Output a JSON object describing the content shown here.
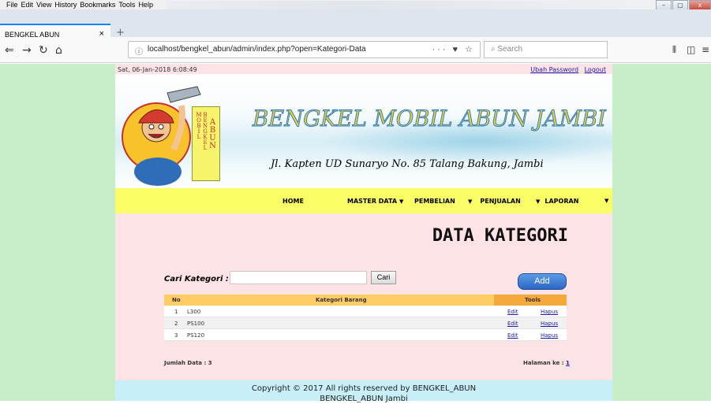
{
  "browser": {
    "menu": [
      "File",
      "Edit",
      "View",
      "History",
      "Bookmarks",
      "Tools",
      "Help"
    ],
    "tab_title": "BENGKEL ABUN",
    "tab_close": "×",
    "new_tab": "+",
    "url": "localhost/bengkel_abun/admin/index.php?open=Kategori-Data",
    "url_actions": "··· ♥ ☆",
    "search_placeholder": "Search",
    "win_controls": [
      "–",
      "▢",
      "x"
    ]
  },
  "page": {
    "datetime": "Sat, 06-Jan-2018 6:08:49",
    "links": [
      "Ubah Password",
      "Logout"
    ],
    "banner": {
      "title": "BENGKEL MOBIL ABUN JAMBI",
      "address": "Jl. Kapten UD Sunaryo No. 85 Talang Bakung, Jambi",
      "sign_left": "BENGKEL MOBIL",
      "sign_right": "ABUN"
    },
    "nav": {
      "home": "HOME",
      "master": "MASTER DATA",
      "pembelian": "PEMBELIAN",
      "penjualan": "PENJUALAN",
      "laporan": "LAPORAN",
      "caret": "▼"
    },
    "heading": "DATA KATEGORI",
    "search": {
      "label": "Cari Kategori :",
      "value": "",
      "button": "Cari"
    },
    "add_button": "Add",
    "table": {
      "headers": {
        "no": "No",
        "kategori": "Kategori Barang",
        "tools": "Tools"
      },
      "rows": [
        {
          "no": "1",
          "name": "L300",
          "edit": "Edit",
          "hapus": "Hapus"
        },
        {
          "no": "2",
          "name": "PS100",
          "edit": "Edit",
          "hapus": "Hapus"
        },
        {
          "no": "3",
          "name": "PS120",
          "edit": "Edit",
          "hapus": "Hapus"
        }
      ]
    },
    "total": "Jumlah Data : 3",
    "page_label": "Halaman ke :",
    "page_number": "1",
    "footer": [
      "Copyright © 2017 All rights reserved by BENGKEL_ABUN",
      "BENGKEL_ABUN Jambi"
    ]
  },
  "colors": {
    "page_bg": "#fde3e5",
    "side_bg": "#c8eec9",
    "nav_bg": "#fbfd66",
    "table_head": "#ffcc66",
    "tools_head": "#f5a93a",
    "footer_bg": "#c8eef8",
    "link": "#1a1aa8"
  }
}
